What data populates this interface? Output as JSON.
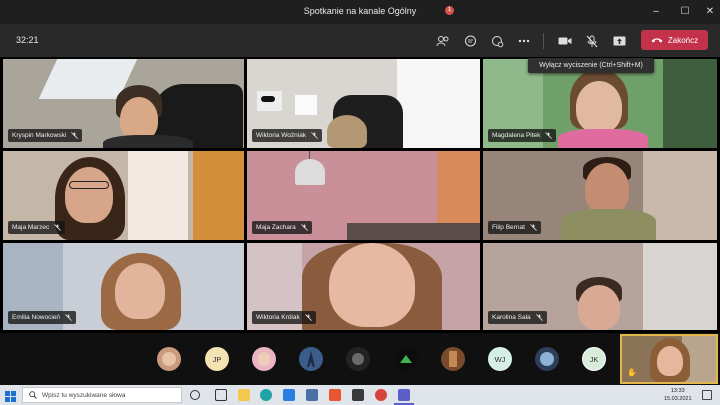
{
  "window": {
    "title": "Spotkanie na kanale Ogólny"
  },
  "toolbar": {
    "timer": "32:21",
    "participants_badge": "1",
    "leave_label": "Zakończ",
    "tooltip": "Wyłącz wyciszenie (Ctrl+Shift+M)"
  },
  "participants": [
    {
      "name": "Kryspin Markowski"
    },
    {
      "name": "Wiktoria Woźniak"
    },
    {
      "name": "Magdalena Pitek"
    },
    {
      "name": "Maja Marzec"
    },
    {
      "name": "Maja Zachara"
    },
    {
      "name": "Filip Bernat"
    },
    {
      "name": "Emilia Nowocień"
    },
    {
      "name": "Wiktoria Królak"
    },
    {
      "name": "Karolina Sala"
    }
  ],
  "strip": {
    "initials_1": "JP",
    "initials_2": "WJ",
    "initials_3": "JK"
  },
  "taskbar": {
    "search_placeholder": "Wpisz tu wyszukiwane słowa",
    "time": "13:33",
    "date": "15.03.2021"
  },
  "colors": {
    "accent_leave": "#c4314b",
    "toolbar_bg": "#292929",
    "selfview_border": "#e3b74a"
  }
}
